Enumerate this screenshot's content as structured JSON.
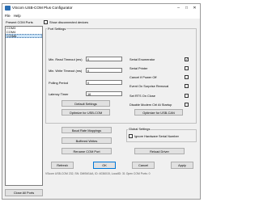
{
  "window": {
    "title": "VScom USB-COM Plus Configurator",
    "controls": {
      "minimize": "–",
      "maximize": "□",
      "close": "✕"
    }
  },
  "menu": {
    "items": [
      "File",
      "Help"
    ]
  },
  "ports_panel": {
    "label": "Present COM Ports",
    "show_disconnected": {
      "label": "Show disconnected devices",
      "checked": false
    },
    "ports": [
      {
        "name": "COM3",
        "selected": false
      },
      {
        "name": "COM4",
        "selected": false
      },
      {
        "name": "COM6",
        "selected": true
      }
    ],
    "close_all_label": "Close All Ports"
  },
  "port_settings": {
    "label": "Port Settings",
    "fields": [
      {
        "label": "Min. Read Timeout (ms)",
        "value": "0"
      },
      {
        "label": "Min. Write Timeout (ms)",
        "value": "0"
      },
      {
        "label": "Polling Period",
        "value": "0"
      },
      {
        "label": "Latency Timer",
        "value": "16"
      }
    ],
    "checks": [
      {
        "label": "Serial Enumerator",
        "checked": true
      },
      {
        "label": "Serial Printer",
        "checked": false
      },
      {
        "label": "Cancel if Power Off",
        "checked": false
      },
      {
        "label": "Event On Surprise Removal",
        "checked": false
      },
      {
        "label": "Set RTS On Close",
        "checked": false
      },
      {
        "label": "Disable Modem Ctrl At Startup",
        "checked": false
      }
    ],
    "default_settings_label": "Default Settings",
    "optimize_usb_label": "Optimize for USB-COM",
    "optimize_can_label": "Optimize for USB-CAN"
  },
  "left_buttons": {
    "baud_rate": "Baud Rate Mappings",
    "buffered_writes": "Buffered Writes",
    "rename_port": "Rename COM Port"
  },
  "global_settings": {
    "label": "Global Settings",
    "ignore_serial": {
      "label": "Ignore Hardware Serial Number",
      "checked": false
    },
    "reload_driver_label": "Reload Driver"
  },
  "bottom_buttons": {
    "refresh": "Refresh",
    "ok": "OK",
    "cancel": "Cancel",
    "apply": "Apply"
  },
  "status": {
    "text": "VScom USB-COM 232, SN: DM0M1AA, ID: 4036015, LocalID: 31 Open COM Ports: 0"
  }
}
